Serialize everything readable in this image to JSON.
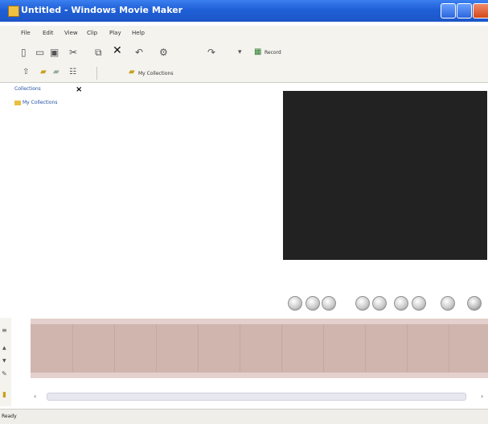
{
  "window": {
    "title": "Untitled - Windows Movie Maker"
  },
  "menu": [
    "File",
    "Edit",
    "View",
    "Clip",
    "Play",
    "Help"
  ],
  "toolbar": {
    "record_label": "Record",
    "collections_label": "My Collections"
  },
  "collections_pane": {
    "header": "Collections",
    "root_item": "My Collections"
  },
  "status": {
    "text": "Ready"
  },
  "colors": {
    "titlebar": "#1f5fd6",
    "preview_bg": "#222222",
    "timeline": "#d0b4ae"
  }
}
